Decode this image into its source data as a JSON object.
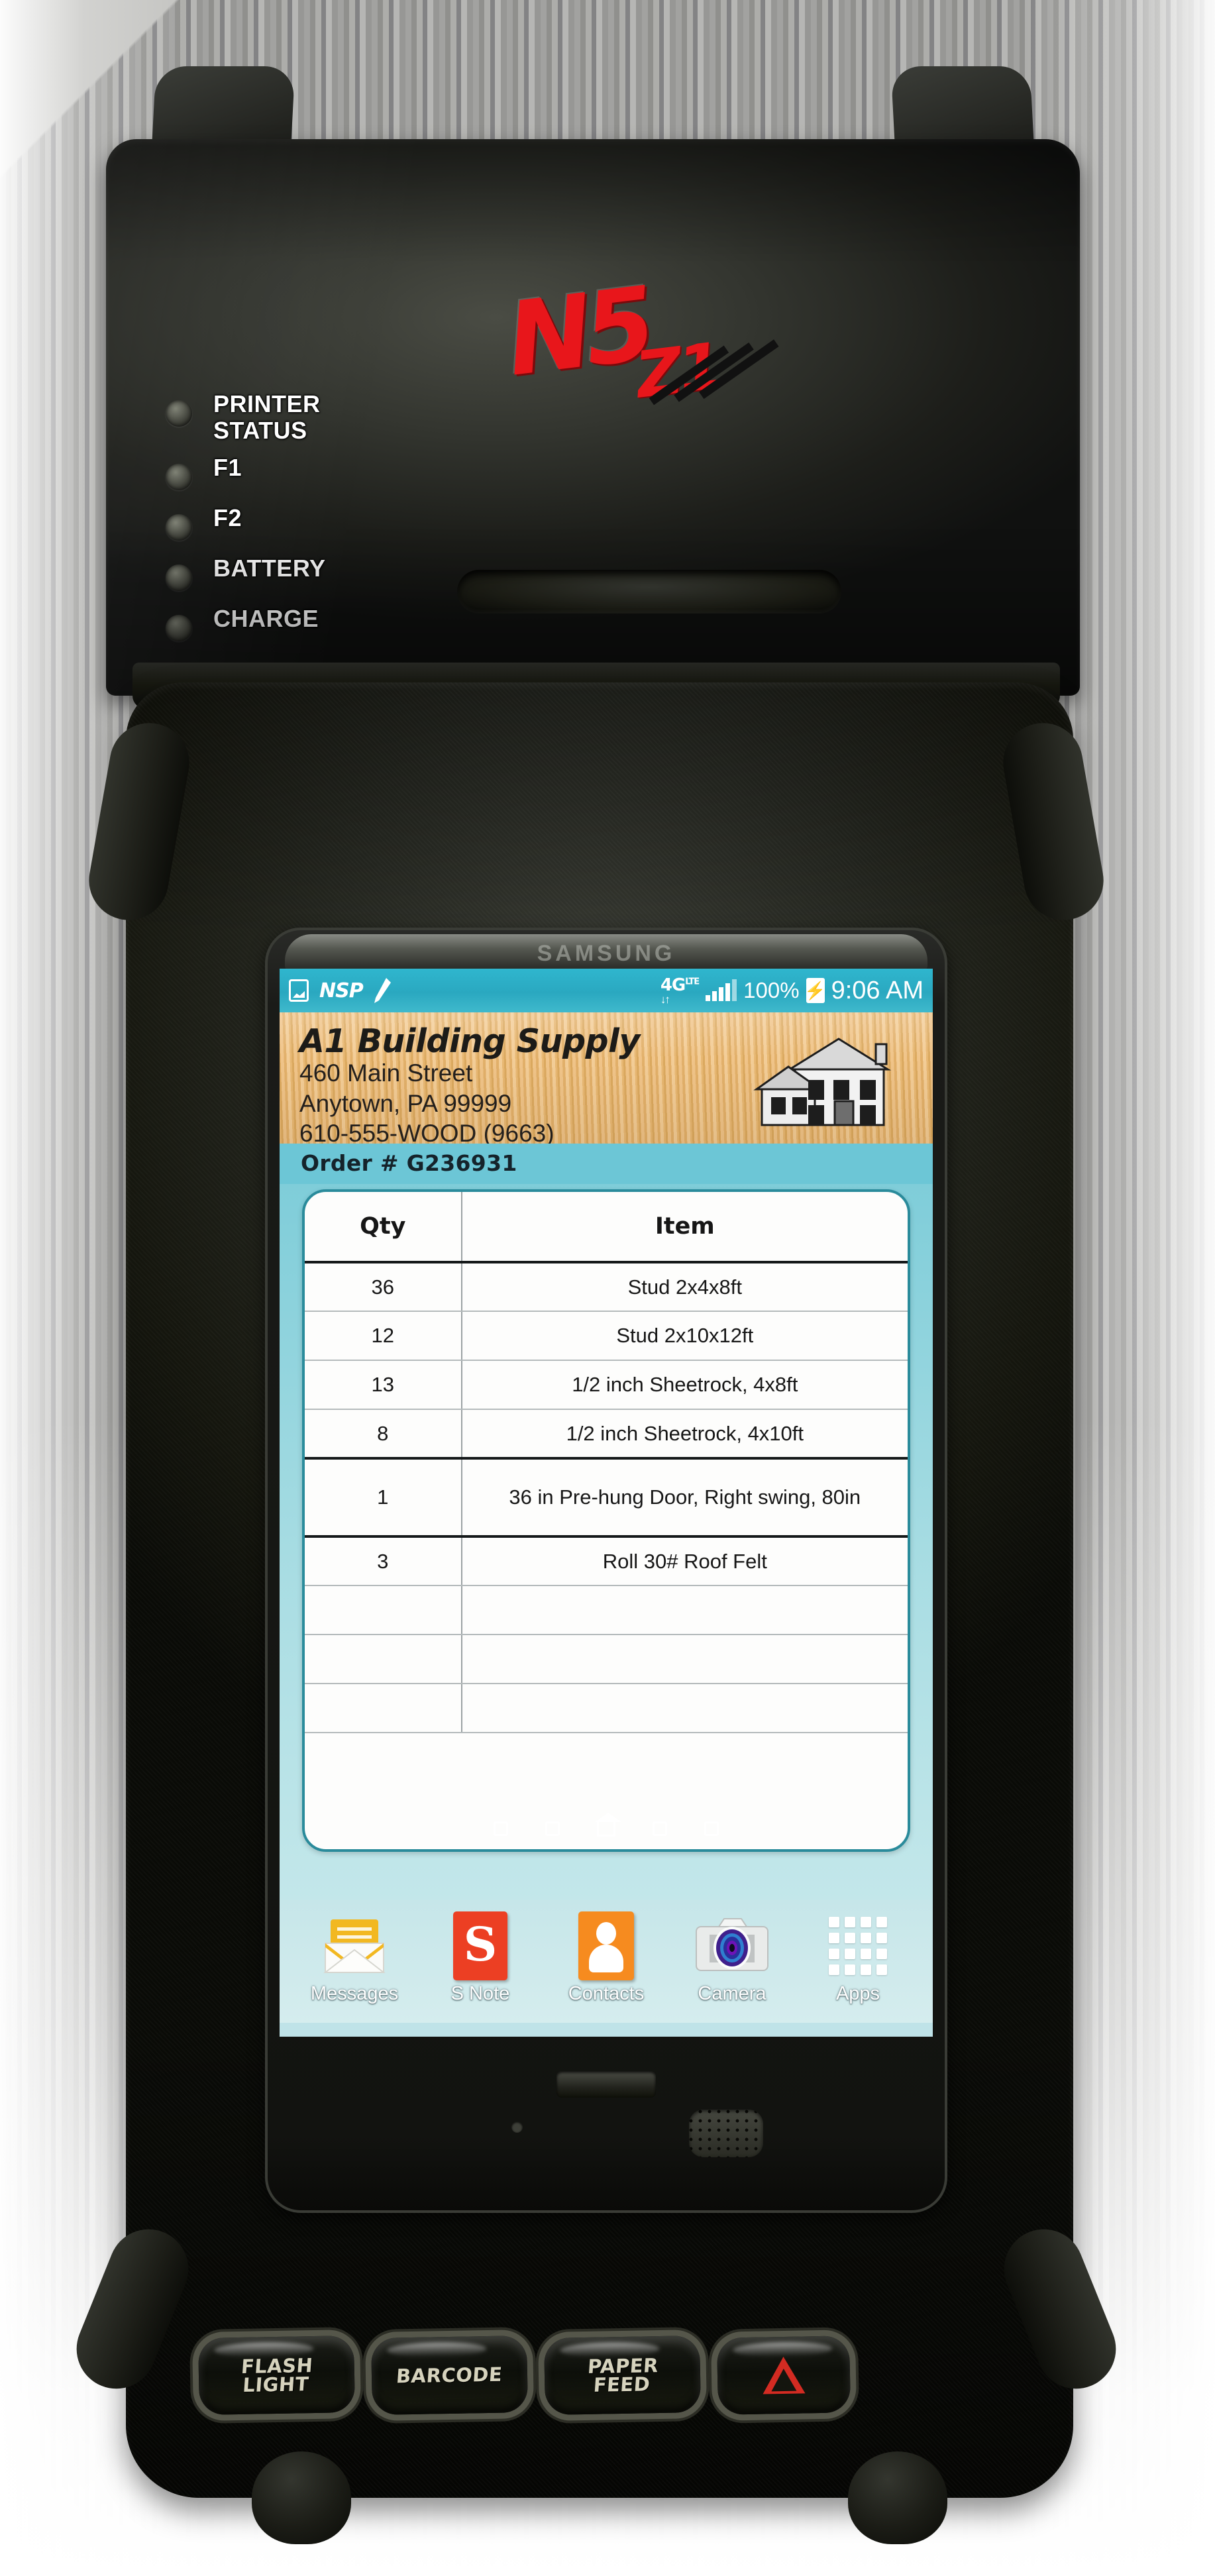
{
  "device": {
    "brand_logo_primary": "N5",
    "brand_logo_secondary": "Z1",
    "phone_brand": "SAMSUNG",
    "leds": [
      {
        "label": "PRINTER\nSTATUS",
        "name": "printer-status"
      },
      {
        "label": "F1",
        "name": "f1"
      },
      {
        "label": "F2",
        "name": "f2"
      },
      {
        "label": "BATTERY",
        "name": "battery"
      },
      {
        "label": "CHARGE",
        "name": "charge"
      }
    ],
    "buttons": [
      {
        "label": "FLASH\nLIGHT",
        "name": "flash-light"
      },
      {
        "label": "BARCODE",
        "name": "barcode"
      },
      {
        "label": "PAPER\nFEED",
        "name": "paper-feed"
      },
      {
        "label": "",
        "name": "emergency"
      }
    ],
    "accent_red": "#e8161b"
  },
  "statusbar": {
    "network": "4G",
    "network_sup": "LTE",
    "battery_percent": "100%",
    "time": "9:06 AM",
    "icons": [
      "screenshot-icon",
      "nsp-icon",
      "pencil-icon"
    ],
    "nsp_label": "NSP"
  },
  "business": {
    "name": "A1 Building Supply",
    "street": "460 Main Street",
    "city_state_zip": "Anytown, PA  99999",
    "phone": "610-555-WOOD (9663)"
  },
  "order": {
    "label": "Order # G236931",
    "columns": [
      "Qty",
      "Item"
    ],
    "rows": [
      {
        "qty": "36",
        "item": "Stud 2x4x8ft"
      },
      {
        "qty": "12",
        "item": "Stud 2x10x12ft"
      },
      {
        "qty": "13",
        "item": "1/2 inch Sheetrock, 4x8ft"
      },
      {
        "qty": "8",
        "item": "1/2 inch Sheetrock, 4x10ft"
      },
      {
        "qty": "1",
        "item": "36 in Pre-hung Door, Right swing, 80in"
      },
      {
        "qty": "3",
        "item": "Roll 30# Roof Felt"
      },
      {
        "qty": "",
        "item": ""
      },
      {
        "qty": "",
        "item": ""
      },
      {
        "qty": "",
        "item": ""
      }
    ]
  },
  "dock": {
    "items": [
      {
        "label": "Messages",
        "icon": "mail-icon"
      },
      {
        "label": "S Note",
        "icon": "s-note-icon",
        "glyph": "S"
      },
      {
        "label": "Contacts",
        "icon": "contacts-icon"
      },
      {
        "label": "Camera",
        "icon": "camera-icon"
      },
      {
        "label": "Apps",
        "icon": "apps-grid-icon"
      }
    ]
  },
  "colors": {
    "status_bar": "#2aa8c0",
    "wood": "#e8b873",
    "card_border": "#2a8b9b",
    "s_note": "#ec3f23",
    "contacts": "#f68b1f"
  }
}
